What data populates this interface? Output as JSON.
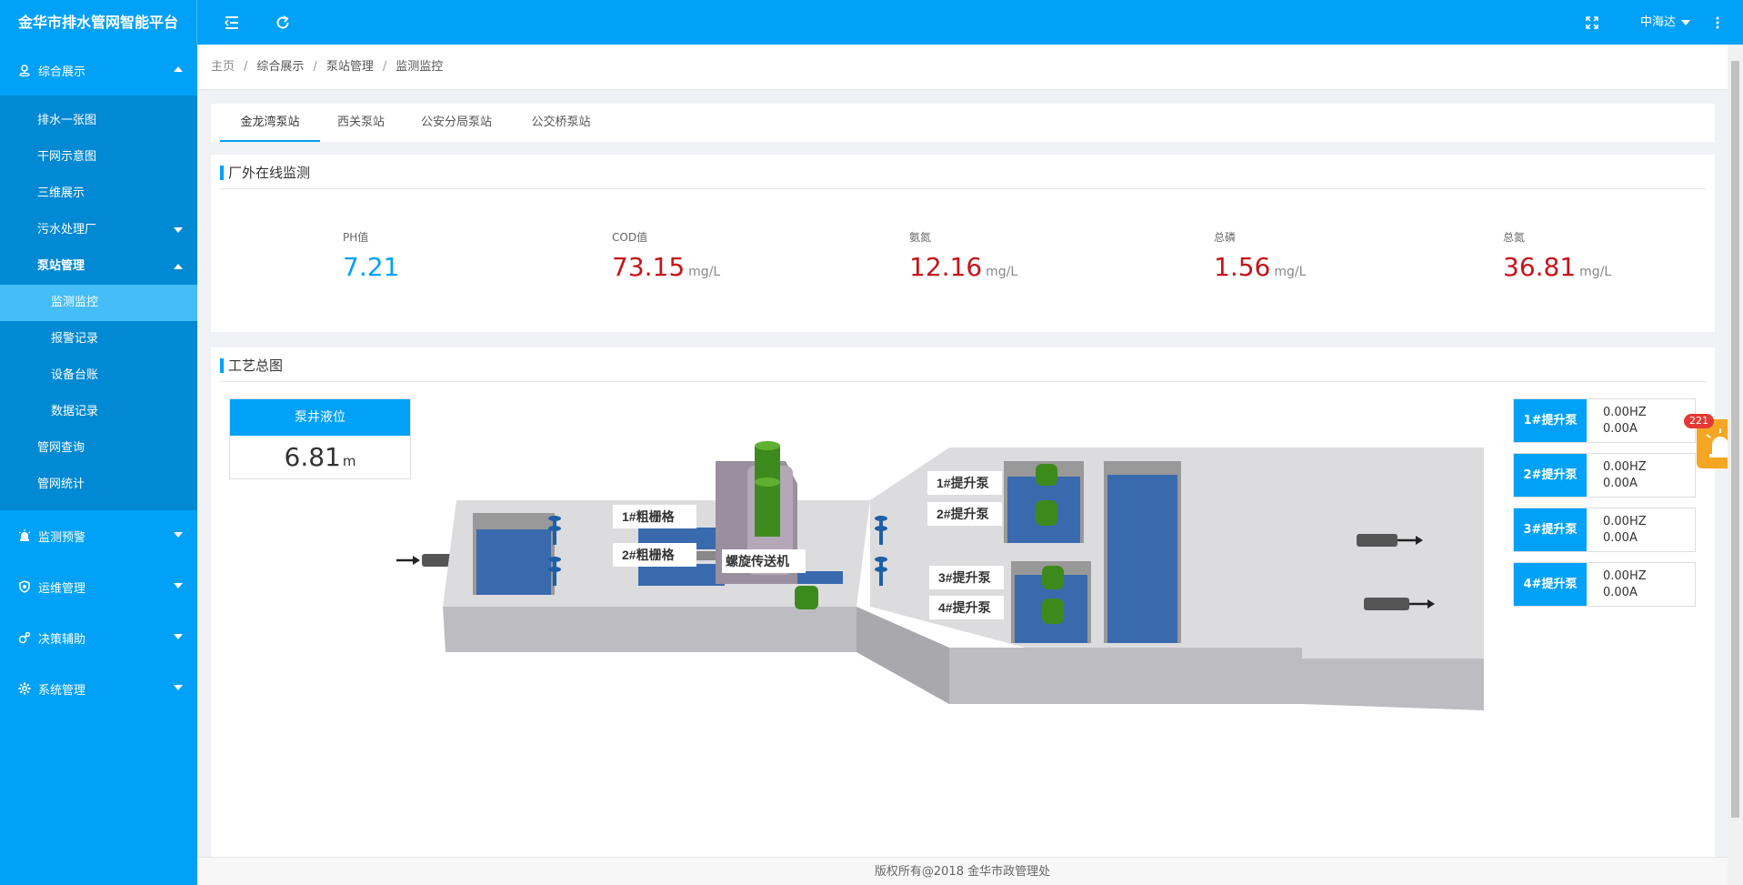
{
  "app": {
    "title": "金华市排水管网智能平台",
    "user": "中海达"
  },
  "sidebar": {
    "groups": [
      {
        "label": "综合展示"
      },
      {
        "label": "监测预警"
      },
      {
        "label": "运维管理"
      },
      {
        "label": "决策辅助"
      },
      {
        "label": "系统管理"
      }
    ],
    "sub": {
      "drain_map": "排水一张图",
      "trunk_map": "干网示意图",
      "three_d": "三维展示",
      "sewage_plant": "污水处理厂",
      "pump_mgmt": "泵站管理",
      "monitor": "监测监控",
      "alarm_records": "报警记录",
      "device_ledger": "设备台账",
      "data_records": "数据记录",
      "pipe_query": "管网查询",
      "pipe_stats": "管网统计"
    }
  },
  "breadcrumb": [
    "主页",
    "综合展示",
    "泵站管理",
    "监测监控"
  ],
  "tabs": [
    "金龙湾泵站",
    "西关泵站",
    "公安分局泵站",
    "公交桥泵站"
  ],
  "monitoring": {
    "title": "厂外在线监测",
    "metrics": [
      {
        "label": "PH值",
        "value": "7.21",
        "unit": ""
      },
      {
        "label": "COD值",
        "value": "73.15",
        "unit": "mg/L"
      },
      {
        "label": "氨氮",
        "value": "12.16",
        "unit": "mg/L"
      },
      {
        "label": "总磷",
        "value": "1.56",
        "unit": "mg/L"
      },
      {
        "label": "总氮",
        "value": "36.81",
        "unit": "mg/L"
      }
    ]
  },
  "process": {
    "title": "工艺总图",
    "level_label": "泵井液位",
    "level_value": "6.81",
    "level_unit": "m",
    "diagram_labels": {
      "coarse1": "1#粗栅格",
      "coarse2": "2#粗栅格",
      "conveyor": "螺旋传送机",
      "pump1": "1#提升泵",
      "pump2": "2#提升泵",
      "pump3": "3#提升泵",
      "pump4": "4#提升泵"
    },
    "pumps": [
      {
        "name": "1#提升泵",
        "hz": "0.00HZ",
        "amp": "0.00A"
      },
      {
        "name": "2#提升泵",
        "hz": "0.00HZ",
        "amp": "0.00A"
      },
      {
        "name": "3#提升泵",
        "hz": "0.00HZ",
        "amp": "0.00A"
      },
      {
        "name": "4#提升泵",
        "hz": "0.00HZ",
        "amp": "0.00A"
      }
    ]
  },
  "alarm": {
    "count": "221"
  },
  "footer": {
    "text": "版权所有@2018 金华市政管理处"
  },
  "colors": {
    "primary": "#00a1f7",
    "value_red": "#c5141a",
    "sidebar_sub": "#0289d3",
    "active_item": "#45bdf7",
    "alarm": "#f5a623"
  },
  "icons": [
    "menu-toggle-icon",
    "refresh-icon",
    "fullscreen-icon",
    "more-vertical-icon",
    "location-icon",
    "alarm-light-icon",
    "shield-gear-icon",
    "decision-icon",
    "gear-icon"
  ]
}
